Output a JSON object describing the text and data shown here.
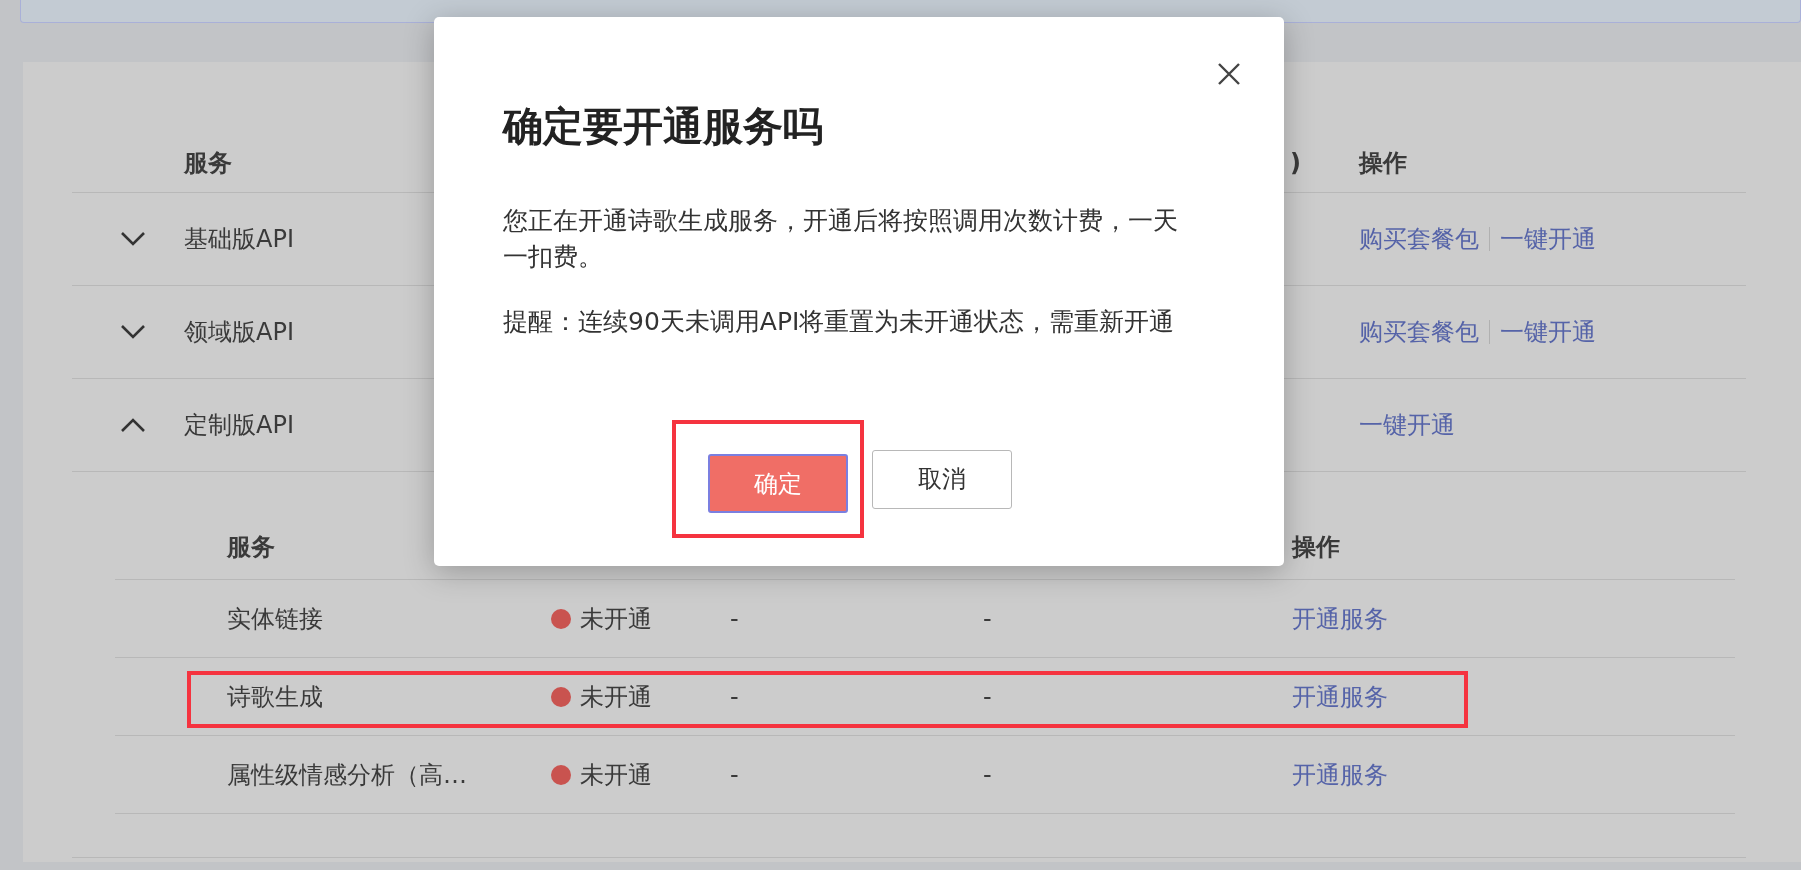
{
  "table": {
    "columns": [
      {
        "label": "服务"
      },
      {
        "label": ")"
      },
      {
        "label": "操作"
      }
    ],
    "rows": [
      {
        "name": "基础版API",
        "expanded": false,
        "actions": [
          "购买套餐包",
          "一键开通"
        ]
      },
      {
        "name": "领域版API",
        "expanded": false,
        "actions": [
          "购买套餐包",
          "一键开通"
        ]
      },
      {
        "name": "定制版API",
        "expanded": true,
        "actions": [
          "一键开通"
        ],
        "sub_table": {
          "columns": [
            {
              "label": "服务"
            },
            {
              "label": "操作"
            }
          ],
          "rows": [
            {
              "name": "实体链接",
              "status": "未开通",
              "color": "#c9534f",
              "column_3": "-",
              "column_4": "-",
              "action": "开通服务",
              "highlighted": false
            },
            {
              "name": "诗歌生成",
              "status": "未开通",
              "color": "#c9534f",
              "column_3": "-",
              "column_4": "-",
              "action": "开通服务",
              "highlighted": true
            },
            {
              "name": "属性级情感分析（高…",
              "status": "未开通",
              "color": "#c9534f",
              "column_3": "-",
              "column_4": "-",
              "action": "开通服务",
              "highlighted": false
            }
          ]
        }
      }
    ]
  },
  "dialog": {
    "title": "确定要开通服务吗",
    "paragraphs": [
      " 您正在开通诗歌生成服务，开通后将按照调用次数计费，一天一扣费。",
      " 提醒：连续90天未调用API将重置为未开通状态，需重新开通"
    ],
    "buttons": [
      {
        "label": "确定",
        "kind": "primary",
        "highlighted": true
      },
      {
        "label": "取消",
        "kind": "default",
        "highlighted": false
      }
    ]
  }
}
